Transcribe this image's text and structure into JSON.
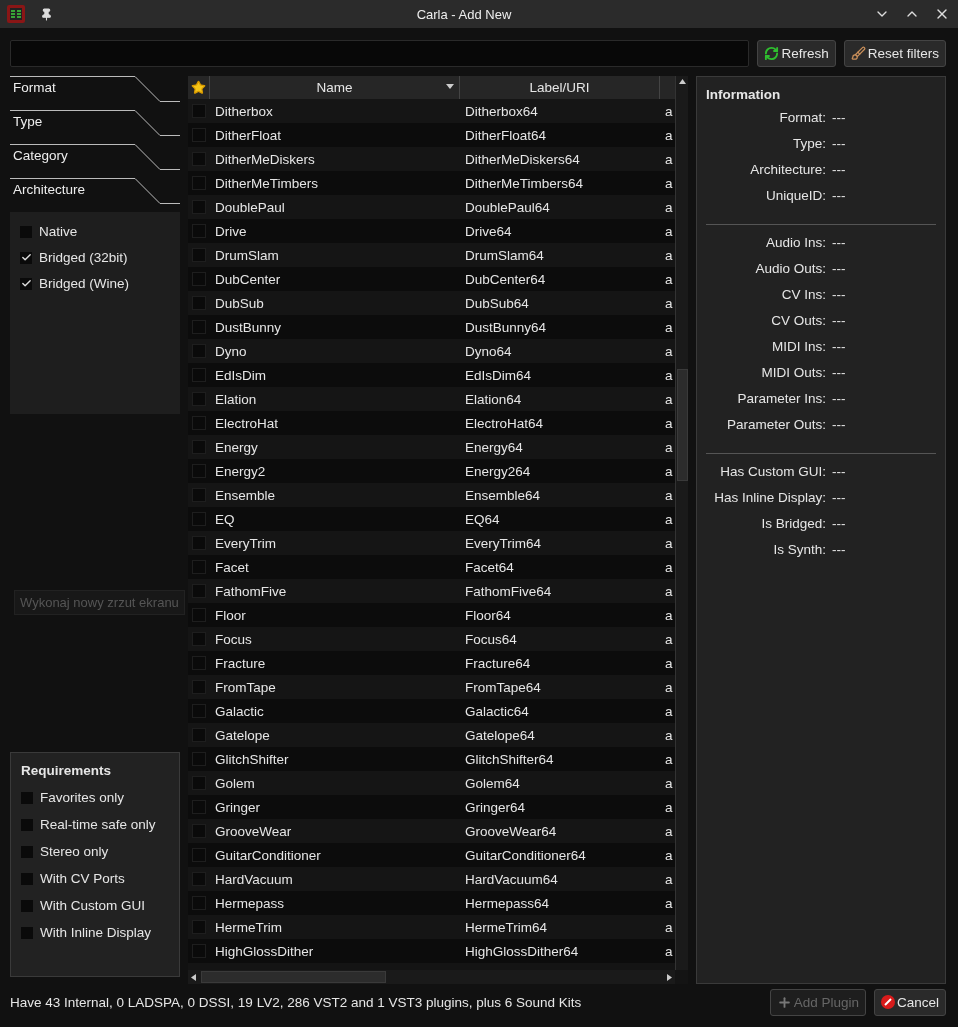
{
  "window": {
    "title": "Carla - Add New"
  },
  "toolbar_buttons": [
    {
      "label": "Refresh",
      "kind": "refresh"
    },
    {
      "label": "Reset filters",
      "kind": "reset"
    }
  ],
  "filter_tabs": [
    {
      "label": "Format"
    },
    {
      "label": "Type"
    },
    {
      "label": "Category"
    },
    {
      "label": "Architecture"
    }
  ],
  "architecture": [
    {
      "label": "Native",
      "checked": false
    },
    {
      "label": "Bridged (32bit)",
      "checked": true
    },
    {
      "label": "Bridged (Wine)",
      "checked": true
    }
  ],
  "tooltip": "Wykonaj nowy zrzut ekranu",
  "requirements": {
    "title": "Requirements",
    "items": [
      {
        "label": "Favorites only",
        "checked": false
      },
      {
        "label": "Real-time safe only",
        "checked": false
      },
      {
        "label": "Stereo only",
        "checked": false
      },
      {
        "label": "With CV Ports",
        "checked": false
      },
      {
        "label": "With Custom GUI",
        "checked": false
      },
      {
        "label": "With Inline Display",
        "checked": false
      }
    ]
  },
  "table": {
    "columns": [
      "Name",
      "Label/URI"
    ],
    "rows": [
      {
        "favorite": false,
        "name": "Ditherbox",
        "label": "Ditherbox64",
        "column_3": "a"
      },
      {
        "favorite": false,
        "name": "DitherFloat",
        "label": "DitherFloat64",
        "column_3": "a"
      },
      {
        "favorite": false,
        "name": "DitherMeDiskers",
        "label": "DitherMeDiskers64",
        "column_3": "a"
      },
      {
        "favorite": false,
        "name": "DitherMeTimbers",
        "label": "DitherMeTimbers64",
        "column_3": "a"
      },
      {
        "favorite": false,
        "name": "DoublePaul",
        "label": "DoublePaul64",
        "column_3": "a"
      },
      {
        "favorite": false,
        "name": "Drive",
        "label": "Drive64",
        "column_3": "a"
      },
      {
        "favorite": false,
        "name": "DrumSlam",
        "label": "DrumSlam64",
        "column_3": "a"
      },
      {
        "favorite": false,
        "name": "DubCenter",
        "label": "DubCenter64",
        "column_3": "a"
      },
      {
        "favorite": false,
        "name": "DubSub",
        "label": "DubSub64",
        "column_3": "a"
      },
      {
        "favorite": false,
        "name": "DustBunny",
        "label": "DustBunny64",
        "column_3": "a"
      },
      {
        "favorite": false,
        "name": "Dyno",
        "label": "Dyno64",
        "column_3": "a"
      },
      {
        "favorite": false,
        "name": "EdIsDim",
        "label": "EdIsDim64",
        "column_3": "a"
      },
      {
        "favorite": false,
        "name": "Elation",
        "label": "Elation64",
        "column_3": "a"
      },
      {
        "favorite": false,
        "name": "ElectroHat",
        "label": "ElectroHat64",
        "column_3": "a"
      },
      {
        "favorite": false,
        "name": "Energy",
        "label": "Energy64",
        "column_3": "a"
      },
      {
        "favorite": false,
        "name": "Energy2",
        "label": "Energy264",
        "column_3": "a"
      },
      {
        "favorite": false,
        "name": "Ensemble",
        "label": "Ensemble64",
        "column_3": "a"
      },
      {
        "favorite": false,
        "name": "EQ",
        "label": "EQ64",
        "column_3": "a"
      },
      {
        "favorite": false,
        "name": "EveryTrim",
        "label": "EveryTrim64",
        "column_3": "a"
      },
      {
        "favorite": false,
        "name": "Facet",
        "label": "Facet64",
        "column_3": "a"
      },
      {
        "favorite": false,
        "name": "FathomFive",
        "label": "FathomFive64",
        "column_3": "a"
      },
      {
        "favorite": false,
        "name": "Floor",
        "label": "Floor64",
        "column_3": "a"
      },
      {
        "favorite": false,
        "name": "Focus",
        "label": "Focus64",
        "column_3": "a"
      },
      {
        "favorite": false,
        "name": "Fracture",
        "label": "Fracture64",
        "column_3": "a"
      },
      {
        "favorite": false,
        "name": "FromTape",
        "label": "FromTape64",
        "column_3": "a"
      },
      {
        "favorite": false,
        "name": "Galactic",
        "label": "Galactic64",
        "column_3": "a"
      },
      {
        "favorite": false,
        "name": "Gatelope",
        "label": "Gatelope64",
        "column_3": "a"
      },
      {
        "favorite": false,
        "name": "GlitchShifter",
        "label": "GlitchShifter64",
        "column_3": "a"
      },
      {
        "favorite": false,
        "name": "Golem",
        "label": "Golem64",
        "column_3": "a"
      },
      {
        "favorite": false,
        "name": "Gringer",
        "label": "Gringer64",
        "column_3": "a"
      },
      {
        "favorite": false,
        "name": "GrooveWear",
        "label": "GrooveWear64",
        "column_3": "a"
      },
      {
        "favorite": false,
        "name": "GuitarConditioner",
        "label": "GuitarConditioner64",
        "column_3": "a"
      },
      {
        "favorite": false,
        "name": "HardVacuum",
        "label": "HardVacuum64",
        "column_3": "a"
      },
      {
        "favorite": false,
        "name": "Hermepass",
        "label": "Hermepass64",
        "column_3": "a"
      },
      {
        "favorite": false,
        "name": "HermeTrim",
        "label": "HermeTrim64",
        "column_3": "a"
      },
      {
        "favorite": false,
        "name": "HighGlossDither",
        "label": "HighGlossDither64",
        "column_3": "a"
      }
    ]
  },
  "information": {
    "title": "Information",
    "groups": [
      [
        {
          "label": "Format:",
          "text": "---"
        },
        {
          "label": "Type:",
          "text": "---"
        },
        {
          "label": "Architecture:",
          "text": "---"
        },
        {
          "label": "UniqueID:",
          "text": "---"
        }
      ],
      [
        {
          "label": "Audio Ins:",
          "text": "---"
        },
        {
          "label": "Audio Outs:",
          "text": "---"
        },
        {
          "label": "CV Ins:",
          "text": "---"
        },
        {
          "label": "CV Outs:",
          "text": "---"
        },
        {
          "label": "MIDI Ins:",
          "text": "---"
        },
        {
          "label": "MIDI Outs:",
          "text": "---"
        },
        {
          "label": "Parameter Ins:",
          "text": "---"
        },
        {
          "label": "Parameter Outs:",
          "text": "---"
        }
      ],
      [
        {
          "label": "Has Custom GUI:",
          "text": "---"
        },
        {
          "label": "Has Inline Display:",
          "text": "---"
        },
        {
          "label": "Is Bridged:",
          "text": "---"
        },
        {
          "label": "Is Synth:",
          "text": "---"
        }
      ]
    ]
  },
  "status_bar": "Have 43 Internal, 0 LADSPA, 0 DSSI, 19 LV2, 286 VST2 and 1 VST3 plugins, plus 6 Sound Kits",
  "dialog_buttons": [
    {
      "label": "Add Plugin",
      "kind": "add",
      "disabled": true
    },
    {
      "label": "Cancel",
      "kind": "cancel",
      "disabled": false
    }
  ]
}
